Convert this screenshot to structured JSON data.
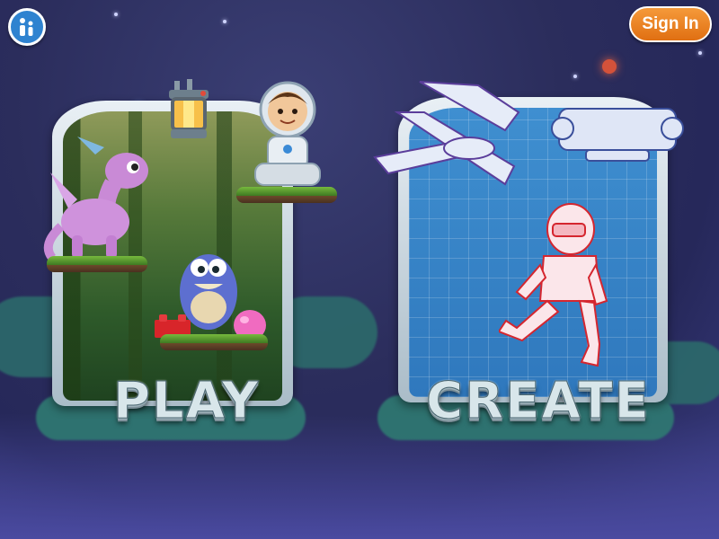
{
  "header": {
    "info_icon": "info-person-icon",
    "signin_label": "Sign In"
  },
  "modes": {
    "play": {
      "label": "PLAY"
    },
    "create": {
      "label": "CREATE"
    }
  },
  "colors": {
    "background": "#2b2d5c",
    "signin": "#e8801f",
    "info": "#2f83d0",
    "blueprint": "#3a88c9",
    "jungle": "#2e5a2a"
  }
}
